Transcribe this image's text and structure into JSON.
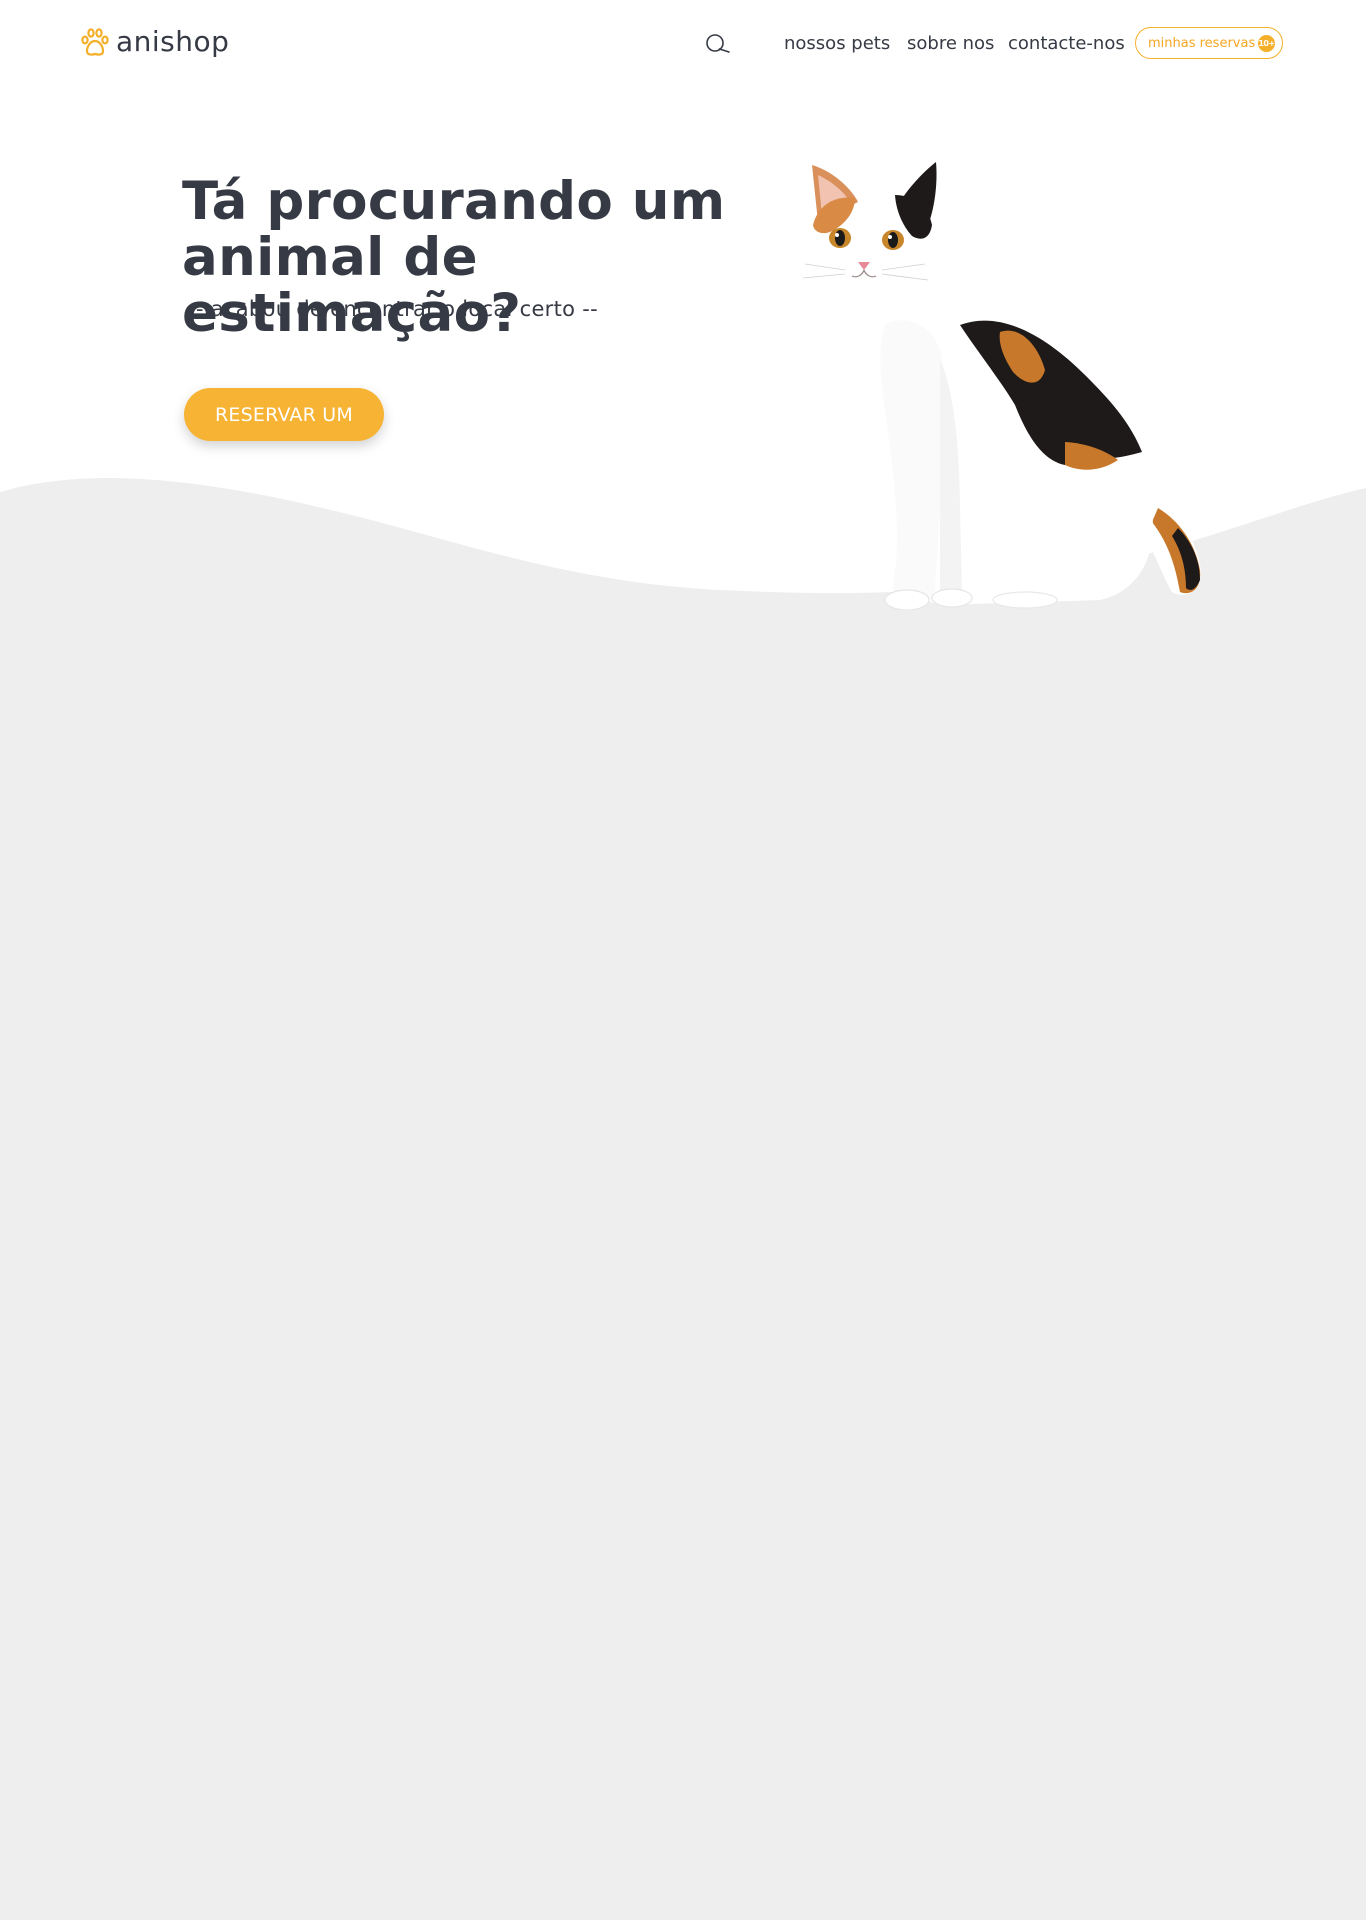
{
  "brand": {
    "name": "anishop",
    "accent_color": "#f5b02b",
    "text_color": "#363a44",
    "logo_icon": "paw-icon"
  },
  "header": {
    "search_icon": "search-icon",
    "nav": {
      "pets": "nossos pets",
      "about": "sobre nos",
      "contact": "contacte-nos"
    },
    "reservations": {
      "label": "minhas reservas",
      "badge": "10+"
    }
  },
  "hero": {
    "title": "Tá procurando um animal de estimação?",
    "subtitle": "-- acabou de encontrar o local certo --",
    "cta": "RESERVAR UM",
    "image": "calico-cat"
  },
  "colors": {
    "page_background": "#eeeeee",
    "hero_background": "#ffffff",
    "button": "#f7b334"
  }
}
